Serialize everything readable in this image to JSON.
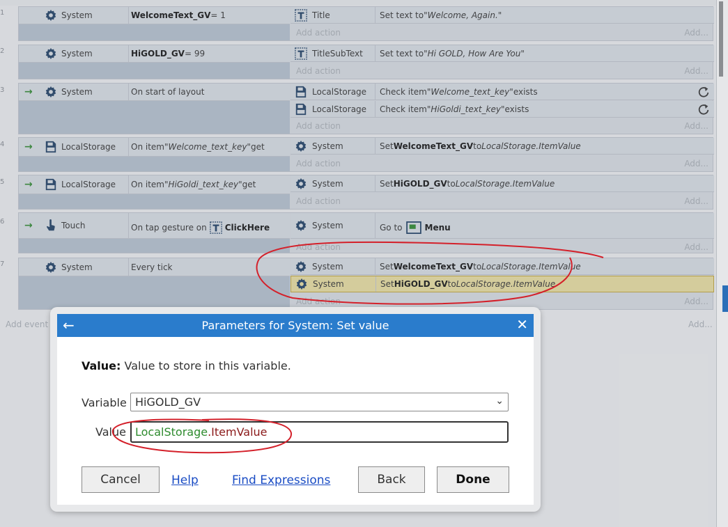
{
  "row_numbers": [
    "1",
    "2",
    "3",
    "4",
    "5",
    "6",
    "7"
  ],
  "events": [
    {
      "condition": {
        "object": "System",
        "text_bold": "WelcomeText_GV",
        "text_rest": " = 1"
      },
      "actions": [
        {
          "object": "Title",
          "text_pre": "Set text to ",
          "text_italic": "\"Welcome, Again.\""
        }
      ]
    },
    {
      "condition": {
        "object": "System",
        "text_bold": "HiGOLD_GV",
        "text_rest": " = 99"
      },
      "actions": [
        {
          "object": "TitleSubText",
          "text_pre": "Set text to ",
          "text_italic": "\"Hi GOLD, How Are You\""
        }
      ]
    },
    {
      "condition": {
        "object": "System",
        "text": "On start of layout"
      },
      "actions": [
        {
          "object": "LocalStorage",
          "text_pre": "Check item ",
          "text_italic": "\"Welcome_text_key\"",
          "text_post": " exists"
        },
        {
          "object": "LocalStorage",
          "text_pre": "Check item ",
          "text_italic": "\"HiGoldi_text_key\"",
          "text_post": " exists"
        }
      ]
    },
    {
      "condition": {
        "object": "LocalStorage",
        "text_pre": "On item ",
        "text_italic": "\"Welcome_text_key\"",
        "text_post": " get"
      },
      "actions": [
        {
          "object": "System",
          "text_pre": "Set ",
          "text_bold": "WelcomeText_GV",
          "text_mid": " to ",
          "text_italic": "LocalStorage.ItemValue"
        }
      ]
    },
    {
      "condition": {
        "object": "LocalStorage",
        "text_pre": "On item ",
        "text_italic": "\"HiGoldi_text_key\"",
        "text_post": " get"
      },
      "actions": [
        {
          "object": "System",
          "text_pre": "Set ",
          "text_bold": "HiGOLD_GV",
          "text_mid": " to ",
          "text_italic": "LocalStorage.ItemValue"
        }
      ]
    },
    {
      "condition": {
        "object": "Touch",
        "text_pre": "On tap gesture on ",
        "text_bold": "ClickHere"
      },
      "actions": [
        {
          "object": "System",
          "text_pre": "Go to ",
          "text_bold": "Menu"
        }
      ]
    },
    {
      "condition": {
        "object": "System",
        "text": "Every tick"
      },
      "actions": [
        {
          "object": "System",
          "text_pre": "Set ",
          "text_bold": "WelcomeText_GV",
          "text_mid": " to ",
          "text_italic": "LocalStorage.ItemValue"
        },
        {
          "object": "System",
          "text_pre": "Set ",
          "text_bold": "HiGOLD_GV",
          "text_mid": " to ",
          "text_italic": "LocalStorage.ItemValue"
        }
      ]
    }
  ],
  "add_action_label": "Add action",
  "add_short_label": "Add...",
  "add_event_label": "Add event",
  "dialog": {
    "title": "Parameters for System: Set value",
    "desc_label": "Value:",
    "desc_text": " Value to store in this variable.",
    "variable_label": "Variable",
    "variable_value": "HiGOLD_GV",
    "value_label": "Value",
    "value_object": "LocalStorage",
    "value_expression": ".ItemValue",
    "cancel": "Cancel",
    "help": "Help",
    "find_expressions": "Find Expressions",
    "back": "Back",
    "done": "Done"
  },
  "colors": {
    "accent": "#2a7ccc",
    "selected_action": "#efe3a3",
    "annotation": "#d4202a"
  }
}
